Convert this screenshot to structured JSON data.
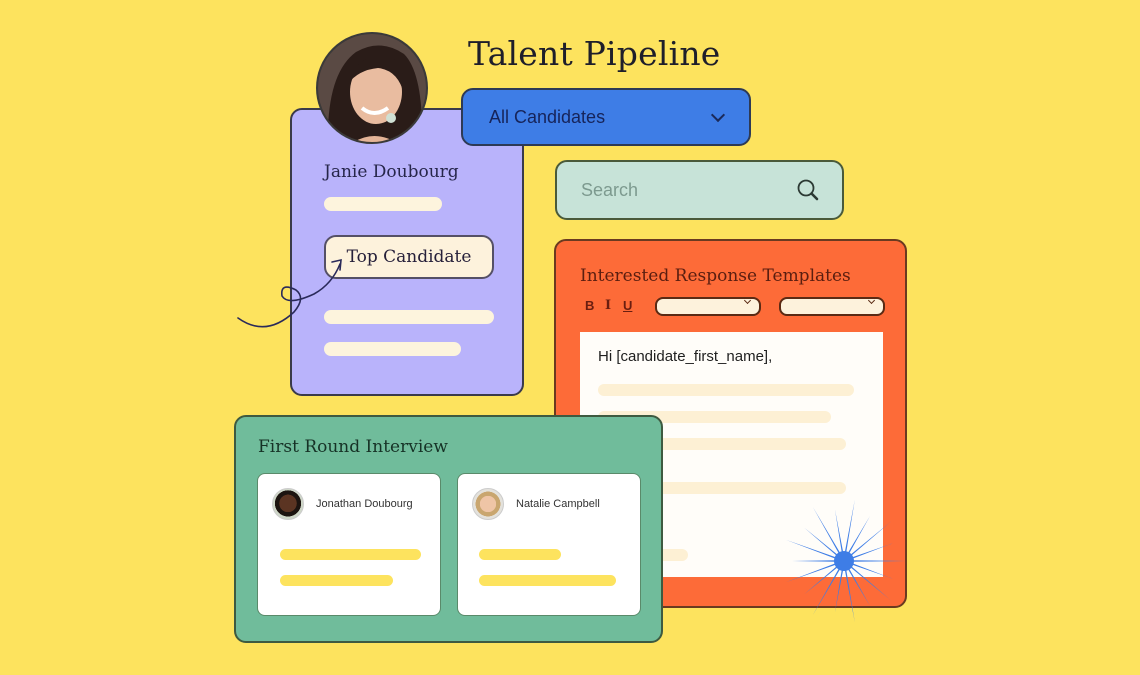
{
  "header": {
    "title": "Talent Pipeline"
  },
  "filter_dropdown": {
    "selected": "All Candidates"
  },
  "search": {
    "placeholder": "Search",
    "value": ""
  },
  "profile_card": {
    "name": "Janie Doubourg",
    "tag": "Top Candidate"
  },
  "templates_panel": {
    "title": "Interested Response Templates",
    "toolbar": {
      "bold": "B",
      "italic": "I",
      "underline": "U",
      "select_1": "",
      "select_2": ""
    },
    "editor_text": "Hi [candidate_first_name],"
  },
  "interview_panel": {
    "title": "First Round Interview",
    "candidates": [
      {
        "name": "Jonathan Doubourg"
      },
      {
        "name": "Natalie Campbell"
      }
    ]
  },
  "colors": {
    "background": "#fde35e",
    "profile_card": "#b9b3fb",
    "dropdown": "#3e7de6",
    "search": "#c7e3d8",
    "templates": "#fd6b38",
    "interview": "#70bc9b",
    "starburst": "#3e7de6"
  }
}
